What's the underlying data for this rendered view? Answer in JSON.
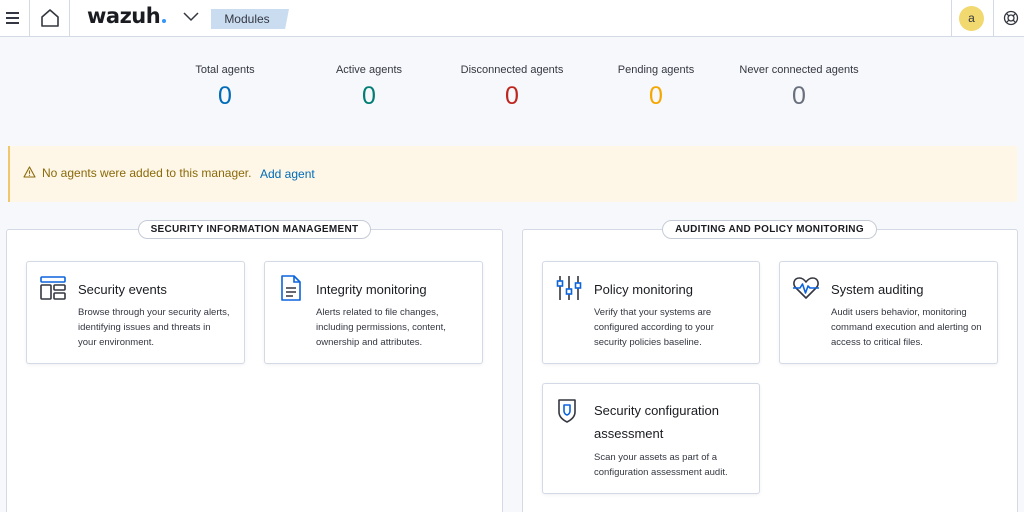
{
  "header": {
    "logo_text": "wazuh",
    "breadcrumb": "Modules",
    "avatar_letter": "a",
    "icons": [
      "hamburger-menu-icon",
      "home-icon",
      "chevron-down-icon",
      "help-icon"
    ]
  },
  "stats": [
    {
      "label": "Total agents",
      "value": "0",
      "color": "#006bb8"
    },
    {
      "label": "Active agents",
      "value": "0",
      "color": "#017d73"
    },
    {
      "label": "Disconnected agents",
      "value": "0",
      "color": "#bd271e"
    },
    {
      "label": "Pending agents",
      "value": "0",
      "color": "#f5a700"
    },
    {
      "label": "Never connected agents",
      "value": "0",
      "color": "#69707d"
    }
  ],
  "callout": {
    "message": "No agents were added to this manager.",
    "link": "Add agent",
    "icon": "warning-icon"
  },
  "panels": {
    "left_title": "SECURITY INFORMATION MANAGEMENT",
    "right_title": "AUDITING AND POLICY MONITORING"
  },
  "cards": {
    "security_events": {
      "title": "Security events",
      "desc_lines": [
        "Browse through your security alerts,",
        "identifying issues and threats in",
        "your environment."
      ],
      "icon": "dashboard-icon"
    },
    "integrity_monitoring": {
      "title": "Integrity monitoring",
      "desc_lines": [
        "Alerts related to file changes,",
        "including permissions, content,",
        "ownership and attributes."
      ],
      "icon": "document-icon"
    },
    "policy_monitoring": {
      "title": "Policy monitoring",
      "desc_lines": [
        "Verify that your systems are",
        "configured according to your",
        "security policies baseline."
      ],
      "icon": "sliders-icon"
    },
    "system_auditing": {
      "title": "System auditing",
      "desc_lines": [
        "Audit users behavior, monitoring",
        "command execution and alerting on",
        "access to critical files."
      ],
      "icon": "heartbeat-icon"
    },
    "sca": {
      "title_lines": [
        "Security configuration",
        "assessment"
      ],
      "desc_lines": [
        "Scan your assets as part of a",
        "configuration assessment audit."
      ],
      "icon": "shield-doc-icon"
    }
  }
}
